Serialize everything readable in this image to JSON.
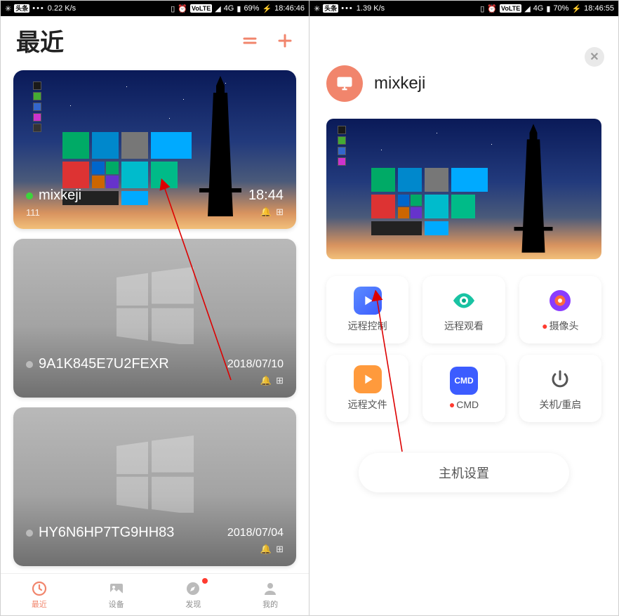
{
  "left": {
    "status": {
      "speed": "0.22 K/s",
      "volte": "VoLTE",
      "net": "4G",
      "battery": "69%",
      "time": "18:46:46"
    },
    "title": "最近",
    "cards": [
      {
        "name": "mixkeji",
        "sub": "111",
        "time": "18:44",
        "online": true
      },
      {
        "name": "9A1K845E7U2FEXR",
        "date": "2018/07/10",
        "online": false
      },
      {
        "name": "HY6N6HP7TG9HH83",
        "date": "2018/07/04",
        "online": false
      }
    ],
    "tabs": [
      {
        "label": "最近",
        "active": true
      },
      {
        "label": "设备"
      },
      {
        "label": "发现",
        "badge": true
      },
      {
        "label": "我的"
      }
    ]
  },
  "right": {
    "status": {
      "speed": "1.39 K/s",
      "volte": "VoLTE",
      "net": "4G",
      "battery": "70%",
      "time": "18:46:55"
    },
    "device_name": "mixkeji",
    "actions": [
      {
        "label": "远程控制",
        "rec": false,
        "color": "#5b8bff"
      },
      {
        "label": "远程观看",
        "rec": false,
        "color": "#19c3a3"
      },
      {
        "label": "摄像头",
        "rec": true,
        "color": "#8a3cff"
      },
      {
        "label": "远程文件",
        "rec": false,
        "color": "#ff9a3c"
      },
      {
        "label": "CMD",
        "rec": true,
        "color": "#3c5cff"
      },
      {
        "label": "关机/重启",
        "rec": false,
        "color": "#555"
      }
    ],
    "settings_label": "主机设置"
  }
}
